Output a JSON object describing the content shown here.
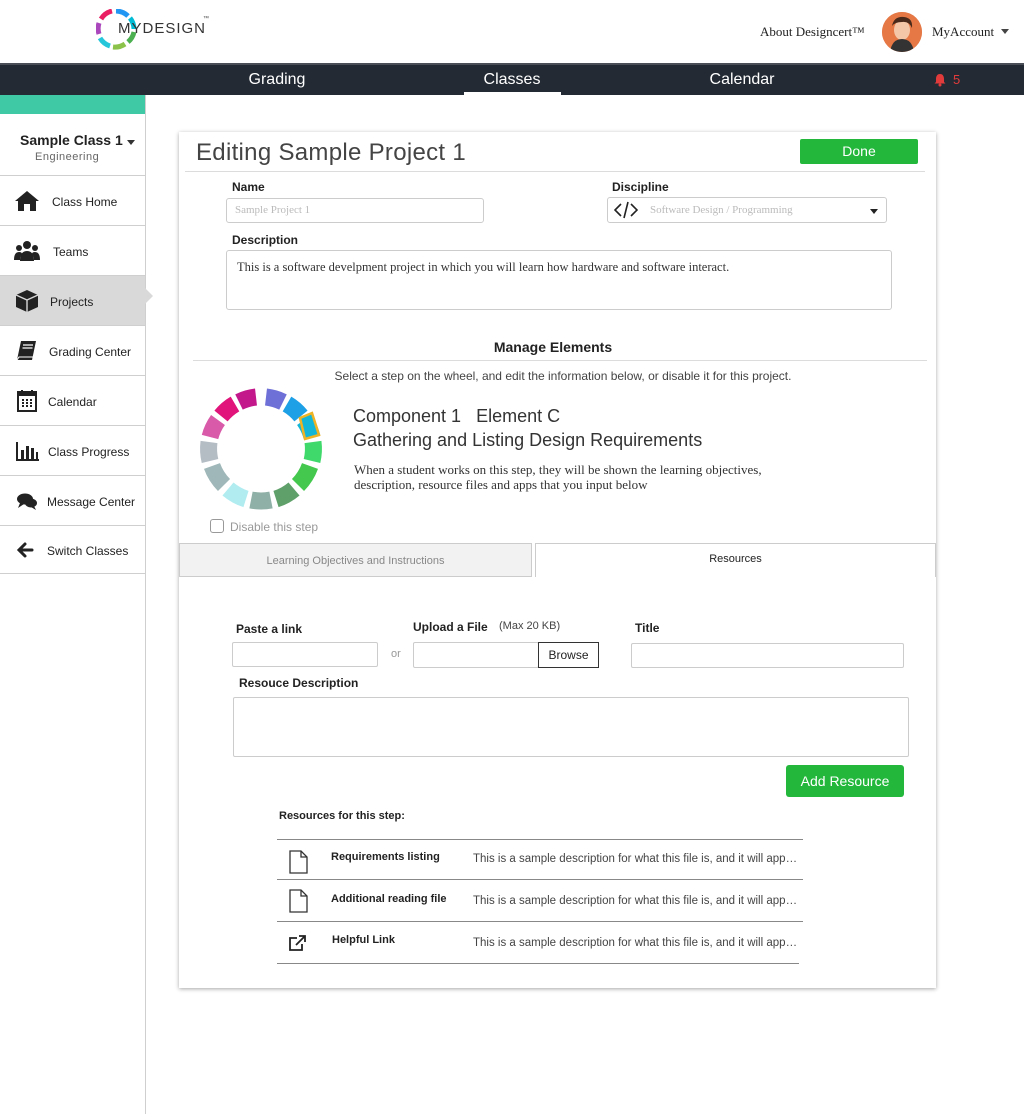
{
  "header": {
    "logo_text": "MYDESIGN",
    "logo_tm": "™",
    "about_label": "About Designcert™",
    "account_label": "MyAccount"
  },
  "nav": {
    "items": [
      {
        "label": "Grading"
      },
      {
        "label": "Classes"
      },
      {
        "label": "Calendar"
      }
    ],
    "active": "Classes",
    "notification_count": "5",
    "notification_color": "#e23b3b"
  },
  "sidebar": {
    "class_name": "Sample Class 1",
    "class_subtitle": "Engineering",
    "items": [
      {
        "label": "Class Home",
        "icon": "home-icon"
      },
      {
        "label": "Teams",
        "icon": "users-icon"
      },
      {
        "label": "Projects",
        "icon": "cube-icon"
      },
      {
        "label": "Grading Center",
        "icon": "book-icon"
      },
      {
        "label": "Calendar",
        "icon": "calendar-icon"
      },
      {
        "label": "Class Progress",
        "icon": "bar-chart-icon"
      },
      {
        "label": "Message Center",
        "icon": "chat-icon"
      },
      {
        "label": "Switch Classes",
        "icon": "arrow-left-icon"
      }
    ],
    "active": "Projects",
    "accent_color": "#3fcaa5"
  },
  "editor": {
    "title": "Editing Sample Project 1",
    "done_label": "Done",
    "name_label": "Name",
    "name_placeholder": "Sample Project 1",
    "discipline_label": "Discipline",
    "discipline_value": "Software Design / Programming",
    "description_label": "Description",
    "description_value": "This is a software develpment project in which you will learn how hardware and software interact."
  },
  "manage": {
    "title": "Manage Elements",
    "subtitle": "Select a step on the wheel, and edit the information below, or disable it for this project.",
    "component_title": "Component 1   Element C",
    "step_title": "Gathering and Listing Design Requirements",
    "step_description": "When a student works on this step, they will be shown the learning objectives, description, resource files and apps that you input below",
    "disable_label": "Disable this step"
  },
  "tabs": {
    "learning": "Learning Objectives and Instructions",
    "resources": "Resources",
    "active": "Resources"
  },
  "resource_form": {
    "paste_label": "Paste a link",
    "or_label": "or",
    "upload_label": "Upload a File",
    "max_label": "(Max 20 KB)",
    "browse_label": "Browse",
    "title_label": "Title",
    "description_label": "Resouce Description",
    "add_label": "Add Resource",
    "primary_color": "#23b83c"
  },
  "resources": {
    "heading": "Resources for this step:",
    "items": [
      {
        "name": "Requirements listing",
        "icon": "file-icon",
        "description": "This is a sample description for what this file is, and it will appear when a student clicks the file."
      },
      {
        "name": "Additional reading file",
        "icon": "file-icon",
        "description": "This is a sample description for what this file is, and it will appear when a student clicks the file."
      },
      {
        "name": "Helpful Link",
        "icon": "external-link-icon",
        "description": "This is a sample description for what this file is, and it will appear when a student clicks the link."
      }
    ]
  }
}
